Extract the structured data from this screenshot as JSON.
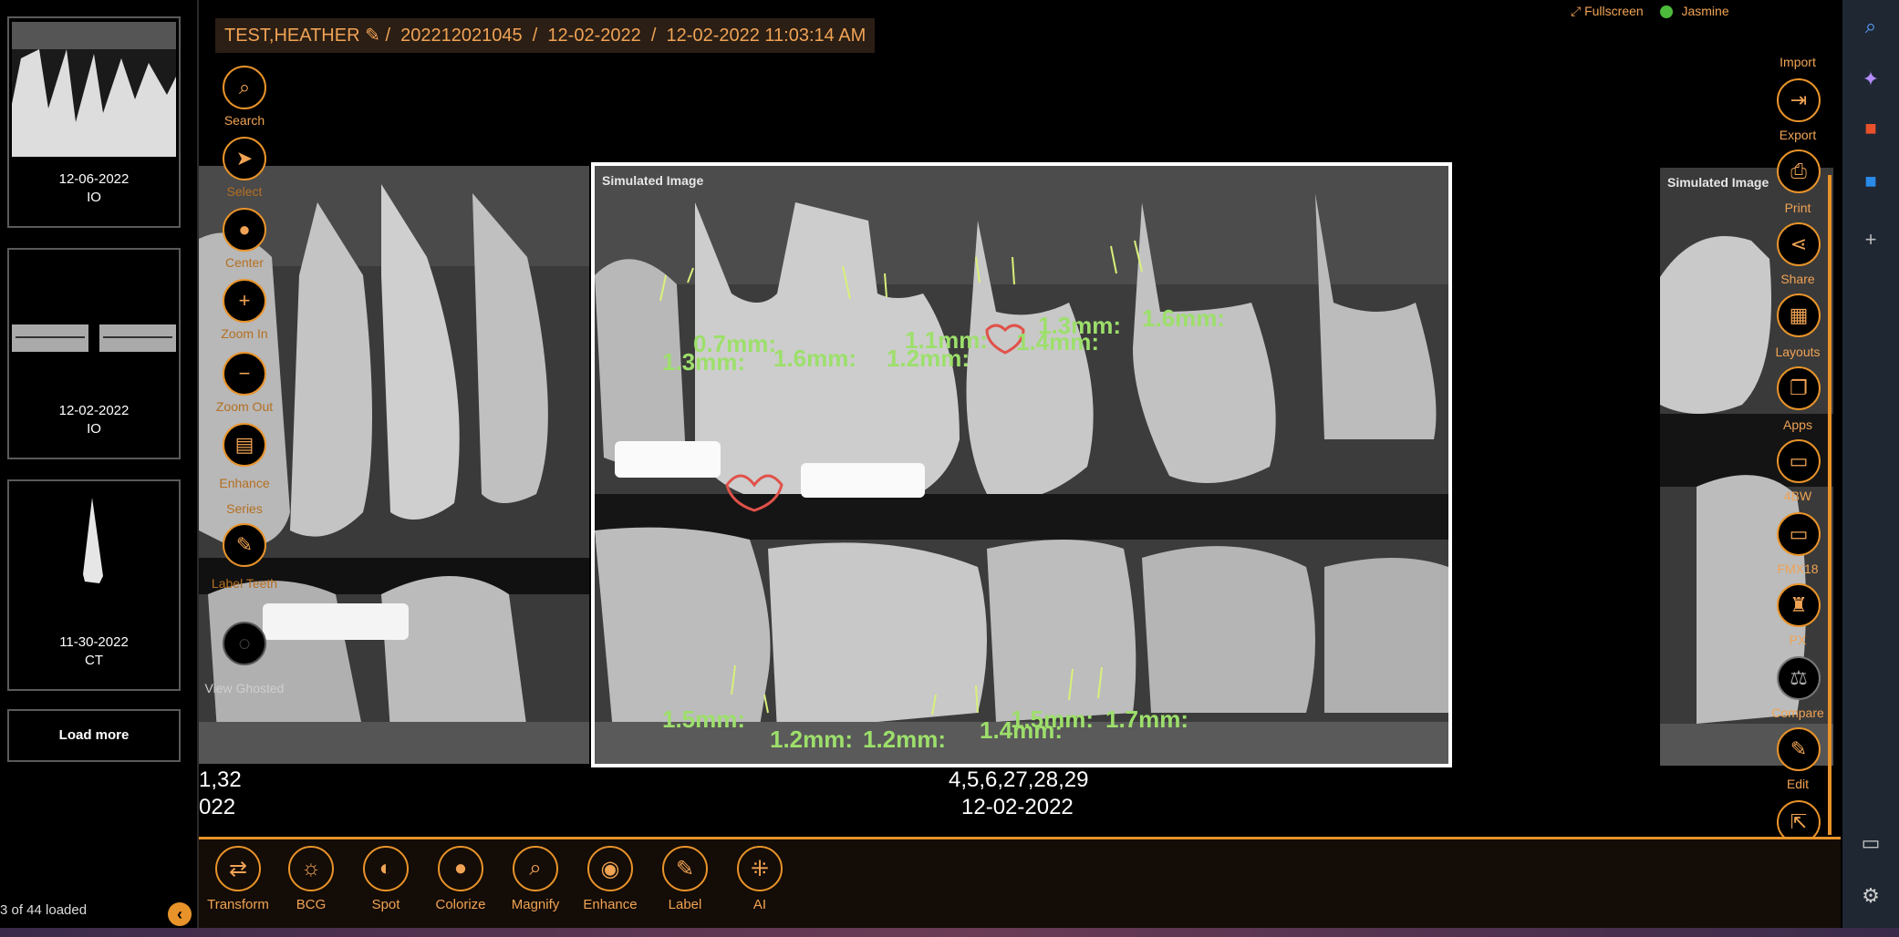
{
  "header": {
    "patient_name": "TEST,HEATHER",
    "separator": "/",
    "study_id": "202212021045",
    "study_date": "12-02-2022",
    "study_datetime": "12-02-2022 11:03:14 AM"
  },
  "top_right": {
    "fullscreen_label": "Fullscreen",
    "user_name": "Jasmine"
  },
  "thumbnails": [
    {
      "date": "12-06-2022",
      "type": "IO"
    },
    {
      "date": "12-02-2022",
      "type": "IO"
    },
    {
      "date": "11-30-2022",
      "type": "CT"
    }
  ],
  "left_panel": {
    "load_more": "Load more",
    "loaded_count": "3 of 44 loaded"
  },
  "left_tools": [
    {
      "label": "Search",
      "icon": "magnifier-icon"
    },
    {
      "label": "Select",
      "icon": "cursor-icon"
    },
    {
      "label": "Center",
      "icon": "center-dot-icon"
    },
    {
      "label": "Zoom In",
      "icon": "plus-icon"
    },
    {
      "label": "Zoom Out",
      "icon": "minus-icon"
    },
    {
      "label": "Enhance Series",
      "icon": "enhance-icon"
    },
    {
      "label": "Label Teeth",
      "icon": "label-icon"
    },
    {
      "label": "View Ghosted",
      "icon": "ghost-icon"
    }
  ],
  "right_tools": [
    {
      "label": "Import",
      "icon": "import-icon"
    },
    {
      "label": "Export",
      "icon": "export-icon"
    },
    {
      "label": "Print",
      "icon": "printer-icon"
    },
    {
      "label": "Share",
      "icon": "share-icon"
    },
    {
      "label": "Layouts",
      "icon": "layout-grid-icon"
    },
    {
      "label": "Apps",
      "icon": "apps-icon"
    },
    {
      "label": "4BW",
      "icon": "bitewing-icon"
    },
    {
      "label": "FMX18",
      "icon": "fmx-icon"
    },
    {
      "label": "PX",
      "icon": "tooth-icon"
    },
    {
      "label": "Compare",
      "icon": "compare-icon"
    },
    {
      "label": "Edit",
      "icon": "edit-icon"
    },
    {
      "label": "",
      "icon": "open-external-icon"
    }
  ],
  "images": {
    "main": {
      "label": "Simulated Image",
      "teeth": "4,5,6,27,28,29",
      "date": "12-02-2022",
      "measurements_top": [
        "0.7mm:",
        "1.3mm:",
        "1.6mm:",
        "1.1mm:",
        "1.2mm:",
        "1.3mm:",
        "1.4mm:",
        "1.6mm:"
      ],
      "measurements_bottom": [
        "1.5mm:",
        "1.2mm:",
        "1.2mm:",
        "1.4mm:",
        "1.5mm:",
        "1.7mm:"
      ]
    },
    "left": {
      "teeth": "1,32",
      "date": "022"
    },
    "right": {
      "label": "Simulated Image"
    }
  },
  "bottom_tools": [
    {
      "label": "Transform",
      "icon": "transform-icon"
    },
    {
      "label": "BCG",
      "icon": "brightness-icon"
    },
    {
      "label": "Spot",
      "icon": "spot-icon"
    },
    {
      "label": "Colorize",
      "icon": "drop-icon"
    },
    {
      "label": "Magnify",
      "icon": "magnify-icon"
    },
    {
      "label": "Enhance",
      "icon": "eye-icon"
    },
    {
      "label": "Label",
      "icon": "label-icon"
    },
    {
      "label": "AI",
      "icon": "ai-icon"
    }
  ],
  "colors": {
    "accent": "#e8932a",
    "measure": "#9ddf6b",
    "caries": "#e0524a"
  }
}
